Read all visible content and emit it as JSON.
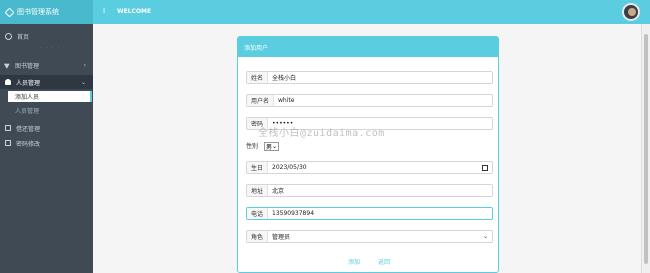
{
  "header": {
    "brand_title": "图书管理系统",
    "toggle_icon": "menu-toggle-icon",
    "toggle_glyph": "I",
    "welcome": "WELCOME"
  },
  "sidebar": {
    "items": [
      {
        "label": "首页",
        "icon": "home-icon"
      },
      {
        "label": "图书管理",
        "icon": "send-icon",
        "caret": "‹"
      },
      {
        "label": "人员管理",
        "icon": "user-icon",
        "caret": "⌄"
      },
      {
        "label": "借还管理",
        "icon": "box-icon"
      },
      {
        "label": "密码修改",
        "icon": "box-icon"
      }
    ],
    "sub_items": [
      {
        "label": "添加人员"
      },
      {
        "label": "人员管理"
      }
    ],
    "divider": "· · · ·"
  },
  "form": {
    "title": "添加用户",
    "fields": {
      "name": {
        "label": "姓名",
        "value": "全栈小白"
      },
      "username": {
        "label": "用户名",
        "value": "white"
      },
      "password": {
        "label": "密码",
        "value": "••••••"
      },
      "gender": {
        "label": "性别",
        "value": "男"
      },
      "birthday": {
        "label": "生日",
        "value": "2023/05/30"
      },
      "address": {
        "label": "地址",
        "value": "北京"
      },
      "phone": {
        "label": "电话",
        "value": "13590937894"
      },
      "role": {
        "label": "角色",
        "value": "管理员"
      }
    },
    "buttons": {
      "submit": "添加",
      "back": "返回"
    }
  },
  "watermark": "全栈小白@zuidaima.com",
  "colors": {
    "accent": "#5bcde0",
    "sidebar_bg": "#3f4a55",
    "sidebar_dark": "#2f3842"
  }
}
